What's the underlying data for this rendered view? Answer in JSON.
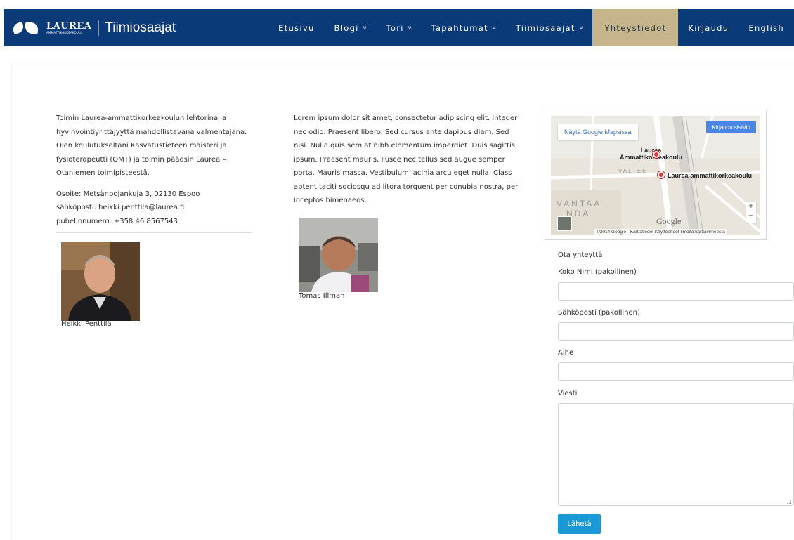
{
  "header": {
    "logo_text": "LAUREA",
    "logo_subtext": "AMMATTIKORKEAKOULU",
    "site_title": "Tiimiosaajat",
    "menu": [
      {
        "label": "Etusivu",
        "chevron": ""
      },
      {
        "label": "Blogi",
        "chevron": "»"
      },
      {
        "label": "Tori",
        "chevron": "»"
      },
      {
        "label": "Tapahtumat",
        "chevron": "»"
      },
      {
        "label": "Tiimiosaajat",
        "chevron": "»"
      },
      {
        "label": "Yhteystiedot",
        "chevron": ""
      },
      {
        "label": "Kirjaudu",
        "chevron": ""
      },
      {
        "label": "English",
        "chevron": ""
      }
    ],
    "active_item": "Yhteystiedot",
    "nav_color": "#0b3a78",
    "active_color": "#c6b58b"
  },
  "column1": {
    "bio": "Toimin Laurea-ammattikorkeakoulun lehtorina ja hyvinvointiyrittäjyyttä mahdollistavana valmentajana. Olen koulutukseltani Kasvatustieteen maisteri ja fysioterapeutti (OMT) ja toimin pääosin Laurea –Otaniemen toimipisteestä.",
    "address": "Osoite: Metsänpojankuja 3, 02130 Espoo",
    "email": "sähköposti: heikki.penttila@laurea.fi",
    "phone": "puhelinnumero. +358 46 8567543",
    "person_name": "Heikki Penttilä"
  },
  "column2": {
    "text": "Lorem ipsum dolor sit amet, consectetur adipiscing elit. Integer nec odio. Praesent libero. Sed cursus ante dapibus diam. Sed nisi. Nulla quis sem at nibh elementum imperdiet. Duis sagittis ipsum. Praesent mauris. Fusce nec tellus sed augue semper porta. Mauris massa. Vestibulum lacinia arcu eget nulla. Class aptent taciti sociosqu ad litora torquent per conubia nostra, per inceptos himenaeos.",
    "person_name": "Tomas Illman"
  },
  "map": {
    "view_larger": "Näytä Google Mapsissa",
    "sign_in": "Kirjaudu sisään",
    "label_laurea_1": "Laurea",
    "label_laurea_2": "Ammattikorkeakoulu",
    "label_laurea_amk": "Laurea-ammattikorkeakoulu",
    "label_valtee": "VALTEE",
    "label_vantaa": "VANTAA",
    "label_nda": "NDA",
    "google": "Google",
    "footer": "©2014 Google - Karttatiedot   Käyttöehdot   Ilmoita karttavirheestä",
    "zoom_in": "+",
    "zoom_out": "−"
  },
  "form": {
    "title": "Ota yhteyttä",
    "name_label": "Koko Nimi (pakollinen)",
    "email_label": "Sähköposti (pakollinen)",
    "subject_label": "Aihe",
    "message_label": "Viesti",
    "name_value": "",
    "email_value": "",
    "subject_value": "",
    "message_value": "",
    "submit_label": "Lähetä",
    "submit_color": "#1a99d6"
  }
}
